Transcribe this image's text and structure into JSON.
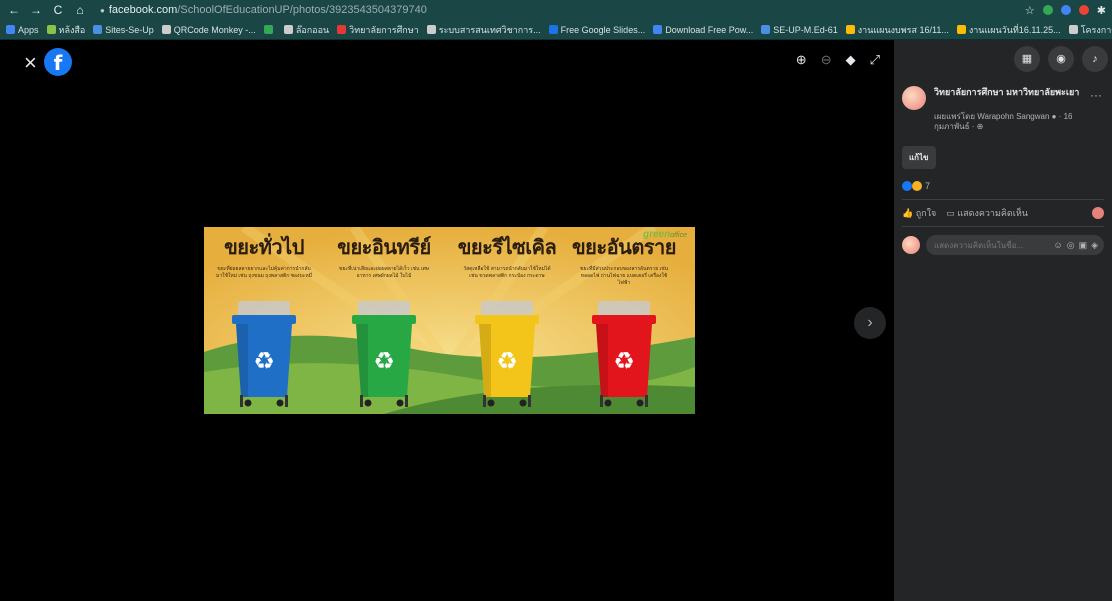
{
  "browser": {
    "url_host": "facebook.com",
    "url_path": "/SchoolOfEducationUP/photos/3923543504379740",
    "bookmarks": [
      {
        "label": "Apps",
        "color": "#4285f4"
      },
      {
        "label": "หล้งสือ",
        "color": "#8bc34a"
      },
      {
        "label": "Sites-Se-Up",
        "color": "#4a90e2"
      },
      {
        "label": "QRCode Monkey -...",
        "color": "#cccccc"
      },
      {
        "label": "",
        "color": "#34a853"
      },
      {
        "label": "ล๊อกออน",
        "color": "#cccccc"
      },
      {
        "label": "วิทยาลัยการศึกษา",
        "color": "#e53935"
      },
      {
        "label": "ระบบสารสนเทศวิชาการ...",
        "color": "#cccccc"
      },
      {
        "label": "Free Google Slides...",
        "color": "#1a73e8"
      },
      {
        "label": "Download Free Pow...",
        "color": "#4285f4"
      },
      {
        "label": "SE-UP-M.Ed-61",
        "color": "#4a90e2"
      },
      {
        "label": "งานแผนงบพรส 16/11...",
        "color": "#fbbc05"
      },
      {
        "label": "งานแผนวันที่16.11.25...",
        "color": "#fbbc05"
      },
      {
        "label": "โครงการ รูปโปรแกรมมีการ...",
        "color": "#cccccc"
      }
    ]
  },
  "viewer": {
    "close_icon": "×",
    "logo_letter": "f",
    "next_icon": "›"
  },
  "photo": {
    "brand": "green",
    "brand_suffix": "office",
    "categories": [
      {
        "title": "ขยะทั่วไป",
        "desc": "ขยะที่ย่อยสลายยากและไม่คุ้มค่าการนำกลับมาใช้ใหม่ เช่น ถุงขนม ถุงพลาสติก ซองบะหมี่",
        "bin_color": "#1f6fc6"
      },
      {
        "title": "ขยะอินทรีย์",
        "desc": "ขยะที่เน่าเสียและย่อยสลายได้เร็ว เช่น เศษอาหาร เศษผักผลไม้ ใบไม้",
        "bin_color": "#27a845"
      },
      {
        "title": "ขยะรีไซเคิล",
        "desc": "วัสดุเหลือใช้ สามารถนำกลับมาใช้ใหม่ได้ เช่น ขวดพลาสติก กระป๋อง กระดาษ",
        "bin_color": "#f3c419"
      },
      {
        "title": "ขยะอันตราย",
        "desc": "ขยะที่มีส่วนประกอบของสารอันตราย เช่น หลอดไฟ ถ่านไฟฉาย แบตเตอรี่ เครื่องใช้ไฟฟ้า",
        "bin_color": "#e2141c"
      }
    ]
  },
  "sidebar": {
    "page_name": "วิทยาลัยการศึกษา มหาวิทยาลัยพะเยา",
    "posted_by": "เผยแพร่โดย Warapohn Sangwan ● · 16 กุมภาพันธ์ · ⊕",
    "edit_label": "แก้ไข",
    "reaction_count": "7",
    "like_label": "ถูกใจ",
    "comment_label": "แสดงความคิดเห็น",
    "comment_placeholder": "แสดงความคิดเห็นในชื่อ..."
  }
}
